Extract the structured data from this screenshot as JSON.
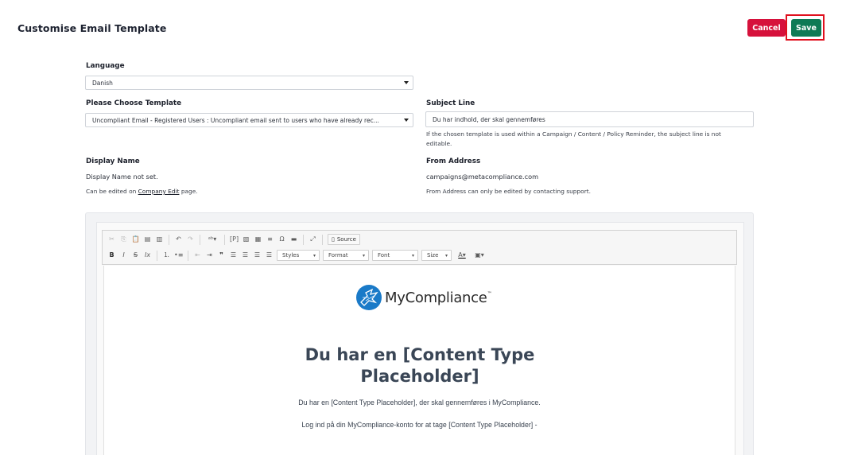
{
  "header": {
    "title": "Customise Email Template",
    "cancel_label": "Cancel",
    "save_label": "Save"
  },
  "form": {
    "language": {
      "label": "Language",
      "value": "Danish"
    },
    "template": {
      "label": "Please Choose Template",
      "value": "Uncompliant Email - Registered Users : Uncompliant email sent to users who have already rec..."
    },
    "subject": {
      "label": "Subject Line",
      "value": "Du har indhold, der skal gennemføres",
      "help_line1": "If the chosen template is used within a Campaign / Content / Policy Reminder, the subject line is not",
      "help_line2": "editable."
    },
    "display_name": {
      "label": "Display Name",
      "value": "Display Name not set.",
      "help_prefix": "Can be edited on ",
      "help_link": "Company Edit",
      "help_suffix": " page."
    },
    "from_address": {
      "label": "From Address",
      "value": "campaigns@metacompliance.com",
      "help": "From Address can only be edited by contacting support."
    }
  },
  "editor": {
    "source_label": "Source",
    "styles_label": "Styles",
    "format_label": "Format",
    "font_label": "Font",
    "size_label": "Size",
    "content": {
      "logo_text": "MyCompliance",
      "logo_tm": "™",
      "heading_line1": "Du har en [Content Type",
      "heading_line2": "Placeholder]",
      "para1": "Du har en [Content Type Placeholder], der skal gennemføres i MyCompliance.",
      "para2": "Log ind på din MyCompliance-konto for at tage [Content Type Placeholder] -"
    }
  },
  "colors": {
    "cancel": "#d6113b",
    "save": "#0e7a55",
    "highlight": "#e0101e",
    "logo_blue": "#1a7ac8"
  }
}
